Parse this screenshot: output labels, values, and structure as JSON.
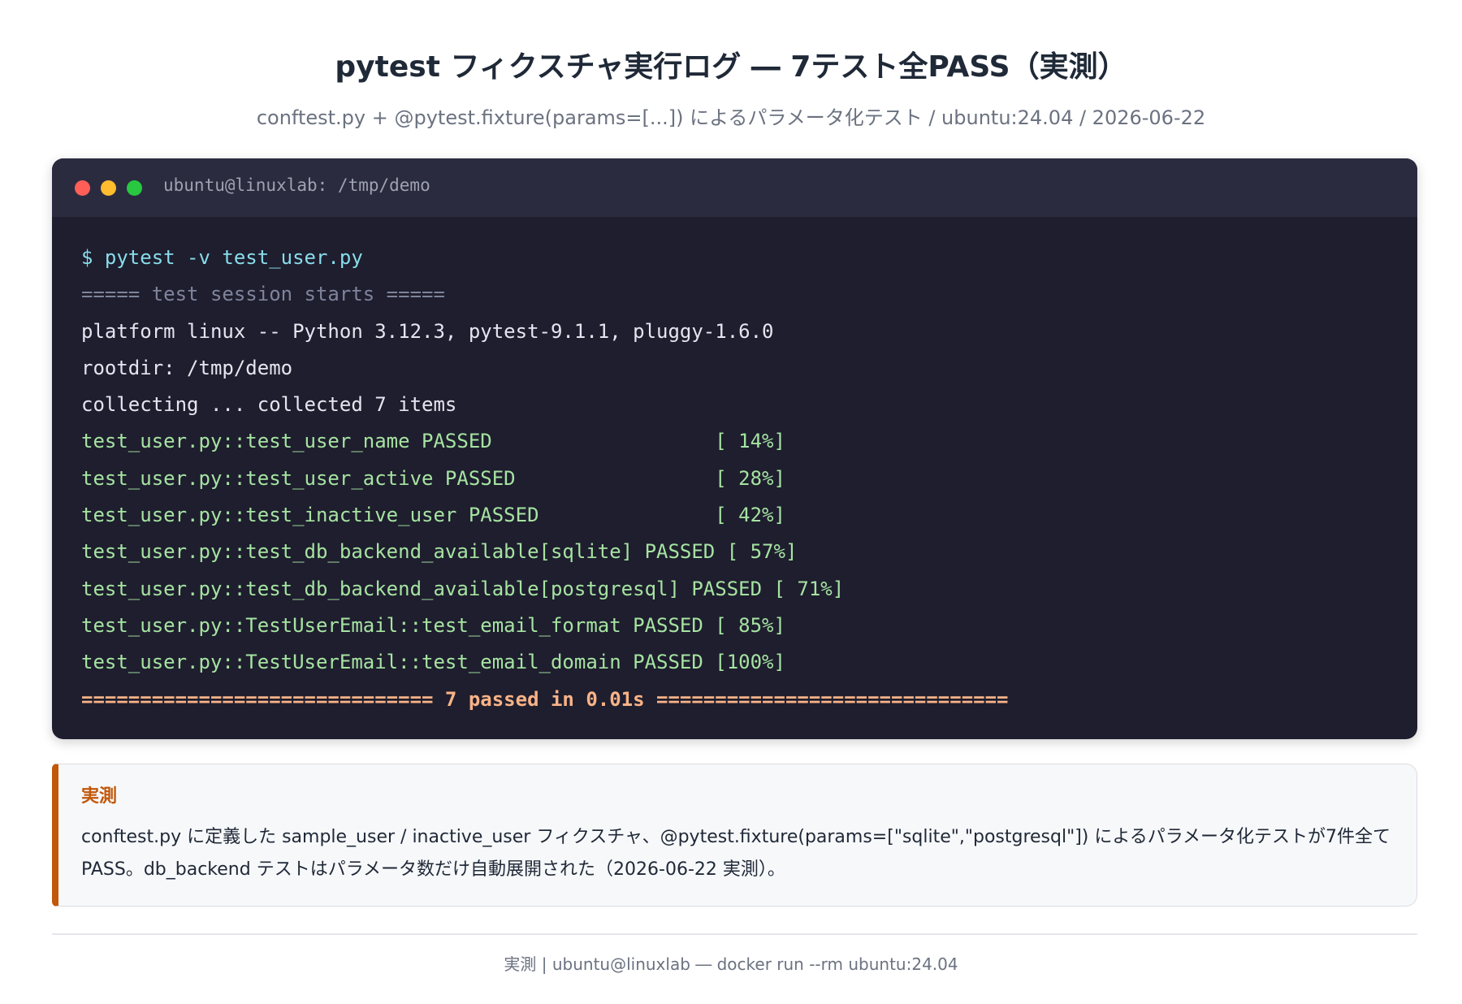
{
  "header": {
    "title": "pytest フィクスチャ実行ログ ― 7テスト全PASS（実測）",
    "subtitle": "conftest.py + @pytest.fixture(params=[...]) によるパラメータ化テスト / ubuntu:24.04 / 2026-06-22"
  },
  "terminal": {
    "window_title": "ubuntu@linuxlab: /tmp/demo",
    "lines": [
      {
        "kind": "cmd",
        "text": "$ pytest -v test_user.py"
      },
      {
        "kind": "dim",
        "text": "===== test session starts ====="
      },
      {
        "kind": "norm",
        "text": "platform linux -- Python 3.12.3, pytest-9.1.1, pluggy-1.6.0"
      },
      {
        "kind": "norm",
        "text": "rootdir: /tmp/demo"
      },
      {
        "kind": "norm",
        "text": "collecting ... collected 7 items"
      },
      {
        "kind": "pass",
        "text": "test_user.py::test_user_name PASSED                   [ 14%]"
      },
      {
        "kind": "pass",
        "text": "test_user.py::test_user_active PASSED                 [ 28%]"
      },
      {
        "kind": "pass",
        "text": "test_user.py::test_inactive_user PASSED               [ 42%]"
      },
      {
        "kind": "pass",
        "text": "test_user.py::test_db_backend_available[sqlite] PASSED [ 57%]"
      },
      {
        "kind": "pass",
        "text": "test_user.py::test_db_backend_available[postgresql] PASSED [ 71%]"
      },
      {
        "kind": "pass",
        "text": "test_user.py::TestUserEmail::test_email_format PASSED [ 85%]"
      },
      {
        "kind": "pass",
        "text": "test_user.py::TestUserEmail::test_email_domain PASSED [100%]"
      },
      {
        "kind": "sum",
        "text": "============================== 7 passed in 0.01s =============================="
      }
    ]
  },
  "note": {
    "label": "実測",
    "text": "conftest.py に定義した sample_user / inactive_user フィクスチャ、@pytest.fixture(params=[\"sqlite\",\"postgresql\"]) によるパラメータ化テストが7件全てPASS。db_backend テストはパラメータ数だけ自動展開された（2026-06-22 実測）。"
  },
  "footer": {
    "text": "実測 | ubuntu@linuxlab ― docker run --rm ubuntu:24.04"
  },
  "colors": {
    "terminal_bg": "#1e1e2e",
    "accent": "#c2580a",
    "pass": "#a6e3a1",
    "summary": "#fab387"
  }
}
